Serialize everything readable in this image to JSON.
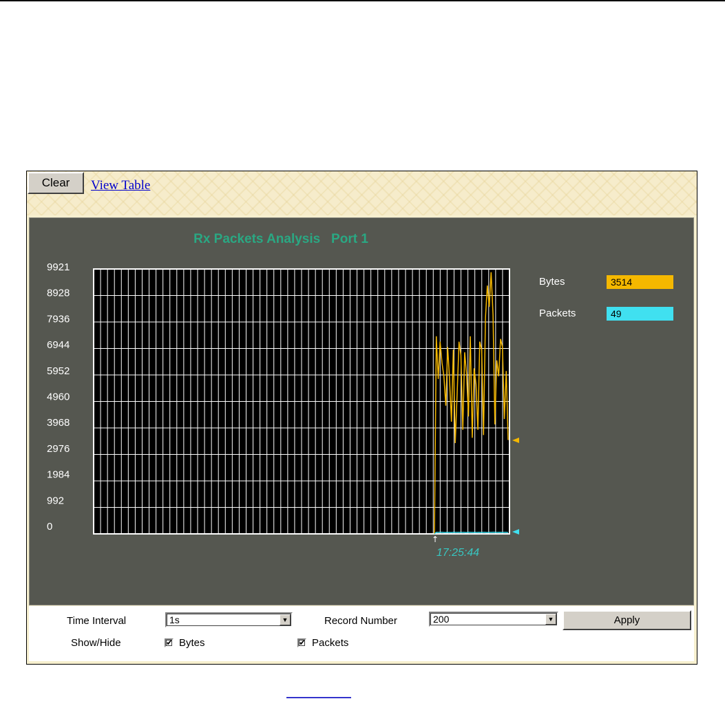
{
  "toolbar": {
    "clear_label": "Clear",
    "view_table_label": "View Table"
  },
  "chart": {
    "title": "Rx Packets Analysis   Port 1",
    "y_ticks": [
      "9921",
      "8928",
      "7936",
      "6944",
      "5952",
      "4960",
      "3968",
      "2976",
      "1984",
      "992",
      "0"
    ],
    "time_label": "17:25:44",
    "grid_cols": 60,
    "grid_rows": 10
  },
  "chart_data": {
    "type": "line",
    "title": "Rx Packets Analysis   Port 1",
    "ylim": [
      0,
      9921
    ],
    "x_start_label": "17:25:44",
    "series": [
      {
        "name": "Bytes",
        "color": "#f5b800",
        "values": [
          0,
          7400,
          5800,
          7200,
          6400,
          5900,
          4800,
          7000,
          5800,
          4200,
          6900,
          3400,
          5200,
          7200,
          6700,
          3900,
          6800,
          6000,
          4400,
          7400,
          3600,
          6200,
          5600,
          3900,
          7200,
          6900,
          3700,
          8100,
          9300,
          8500,
          9800,
          8200,
          4100,
          6500,
          5900,
          7300,
          7000,
          4300,
          6100,
          3514
        ],
        "last_value": "3514"
      },
      {
        "name": "Packets",
        "color": "#40e0f0",
        "values": [
          0,
          60,
          55,
          62,
          58,
          50,
          60,
          55,
          48,
          62,
          57,
          53,
          60,
          58,
          56,
          49,
          61,
          59,
          54,
          60,
          52,
          58,
          55,
          57,
          60,
          49,
          58,
          56,
          61,
          57,
          55,
          60,
          53,
          58,
          56,
          49
        ],
        "last_value": "49"
      }
    ],
    "grid": true,
    "legend": "right"
  },
  "legend": {
    "bytes_label": "Bytes",
    "bytes_value": "3514",
    "bytes_color": "#f5b800",
    "packets_label": "Packets",
    "packets_value": "49",
    "packets_color": "#40e0f0"
  },
  "controls": {
    "time_interval_label": "Time Interval",
    "time_interval_value": "1s",
    "record_number_label": "Record Number",
    "record_number_value": "200",
    "apply_label": "Apply",
    "show_hide_label": "Show/Hide",
    "bytes_checkbox_label": "Bytes",
    "bytes_checked": true,
    "packets_checkbox_label": "Packets",
    "packets_checked": true
  }
}
